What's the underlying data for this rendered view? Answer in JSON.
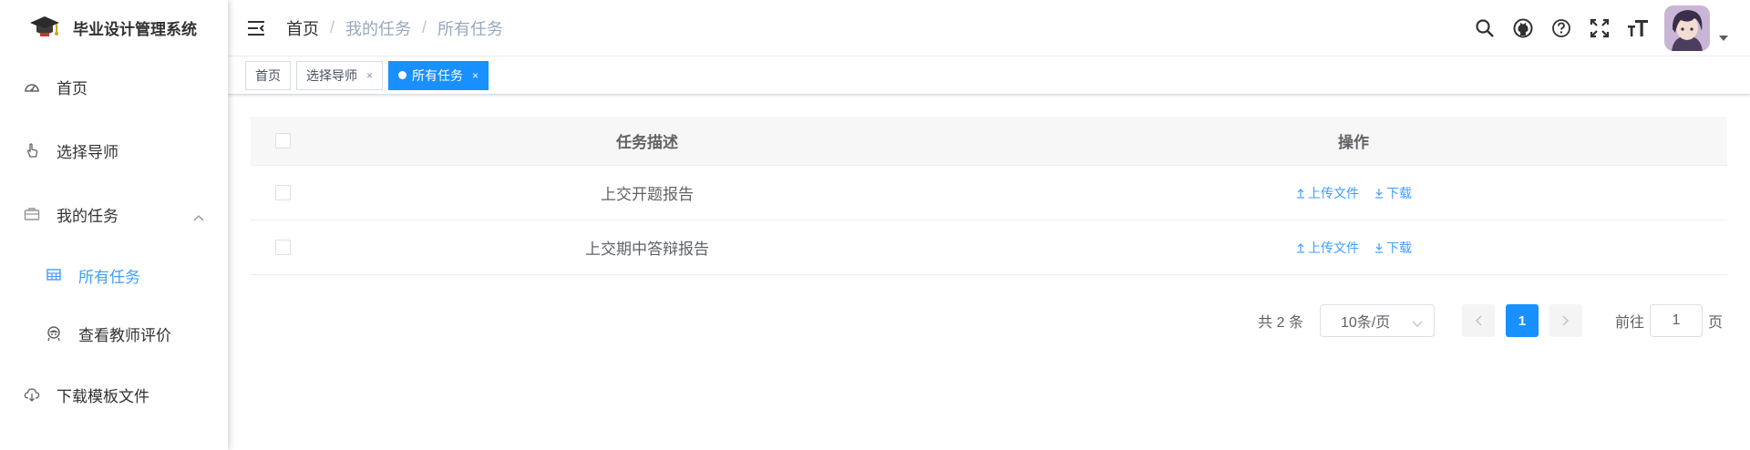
{
  "app": {
    "title": "毕业设计管理系统"
  },
  "sidebar": {
    "items": [
      {
        "label": "首页",
        "icon": "dashboard-icon"
      },
      {
        "label": "选择导师",
        "icon": "hand-pointer-icon"
      },
      {
        "label": "我的任务",
        "icon": "briefcase-icon",
        "expanded": true,
        "children": [
          {
            "label": "所有任务",
            "icon": "table-icon",
            "active": true
          },
          {
            "label": "查看教师评价",
            "icon": "peoples-icon"
          }
        ]
      },
      {
        "label": "下载模板文件",
        "icon": "cloud-download-icon"
      }
    ]
  },
  "navbar": {
    "breadcrumb": [
      "首页",
      "我的任务",
      "所有任务"
    ],
    "icons": [
      "search-icon",
      "github-icon",
      "question-icon",
      "fullscreen-icon",
      "text-size-icon"
    ]
  },
  "tags": [
    {
      "label": "首页",
      "closable": false,
      "active": false
    },
    {
      "label": "选择导师",
      "closable": true,
      "active": false
    },
    {
      "label": "所有任务",
      "closable": true,
      "active": true
    }
  ],
  "table": {
    "headers": {
      "desc": "任务描述",
      "ops": "操作"
    },
    "rows": [
      {
        "desc": "上交开题报告",
        "upload": "上传文件",
        "download": "下载"
      },
      {
        "desc": "上交期中答辩报告",
        "upload": "上传文件",
        "download": "下载"
      }
    ]
  },
  "pagination": {
    "total": "共 2 条",
    "page_size": "10条/页",
    "current_page": "1",
    "jump_prefix": "前往",
    "jump_value": "1",
    "jump_suffix": "页"
  },
  "colors": {
    "primary": "#1890ff",
    "link": "#409EFF"
  }
}
